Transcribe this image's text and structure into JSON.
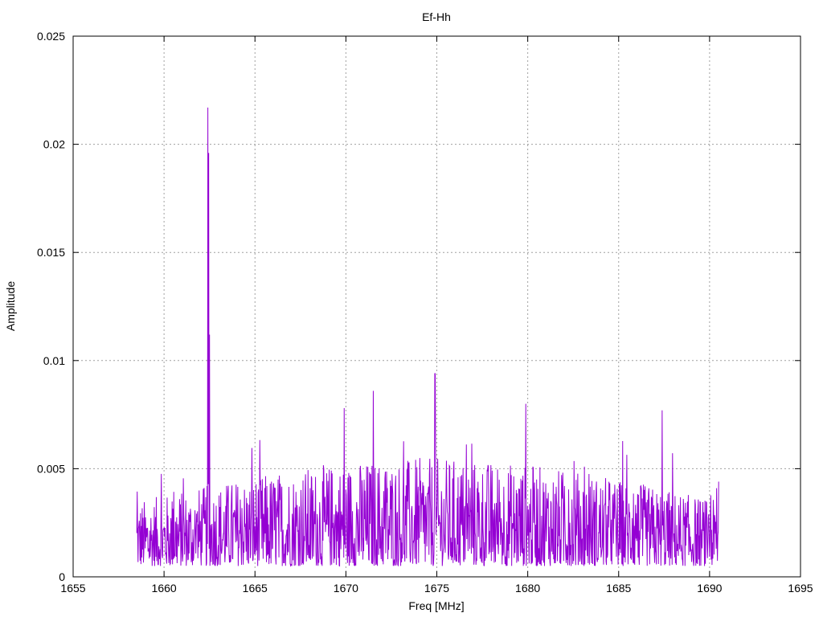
{
  "chart_data": {
    "type": "line",
    "title": "Ef-Hh",
    "xlabel": "Freq [MHz]",
    "ylabel": "Amplitude",
    "xlim": [
      1655,
      1695
    ],
    "ylim": [
      0,
      0.025
    ],
    "xticks": [
      "1655",
      "1660",
      "1665",
      "1670",
      "1675",
      "1680",
      "1685",
      "1690",
      "1695"
    ],
    "yticks": [
      "0",
      "0.005",
      "0.01",
      "0.015",
      "0.02",
      "0.025"
    ],
    "grid": true,
    "line_color": "#9400d3",
    "x_range": [
      1658.5,
      1690.5
    ],
    "noise_floor": [
      0.0005,
      0.0055
    ],
    "peaks": [
      {
        "x": 1662.4,
        "y": 0.0217
      },
      {
        "x": 1662.45,
        "y": 0.0196
      },
      {
        "x": 1662.5,
        "y": 0.0112
      },
      {
        "x": 1669.9,
        "y": 0.0078
      },
      {
        "x": 1671.5,
        "y": 0.0086
      },
      {
        "x": 1674.9,
        "y": 0.0094
      },
      {
        "x": 1679.9,
        "y": 0.008
      },
      {
        "x": 1687.4,
        "y": 0.0077
      },
      {
        "x": 1690.5,
        "y": 0.0044
      }
    ]
  }
}
